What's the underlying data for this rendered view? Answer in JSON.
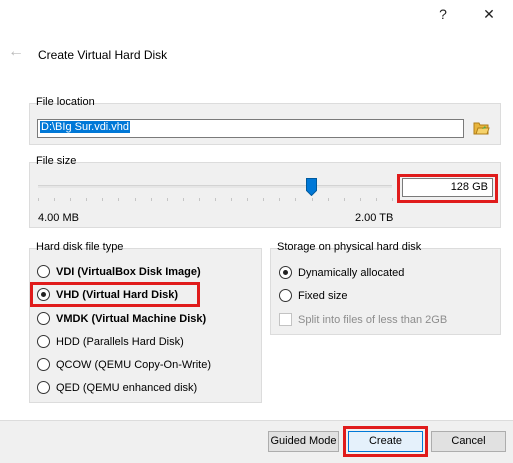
{
  "window": {
    "help_label": "?",
    "close_label": "✕"
  },
  "header": {
    "title": "Create Virtual Hard Disk"
  },
  "file_location": {
    "legend": "File location",
    "value": "D:\\BIg Sur.vdi.vhd"
  },
  "file_size": {
    "legend": "File size",
    "value": "128 GB",
    "min_label": "4.00 MB",
    "max_label": "2.00 TB",
    "slider_fraction": 0.77
  },
  "disk_type": {
    "legend": "Hard disk file type",
    "options": [
      {
        "label": "VDI (VirtualBox Disk Image)",
        "checked": false
      },
      {
        "label": "VHD (Virtual Hard Disk)",
        "checked": true
      },
      {
        "label": "VMDK (Virtual Machine Disk)",
        "checked": false
      },
      {
        "label": "HDD (Parallels Hard Disk)",
        "checked": false
      },
      {
        "label": "QCOW (QEMU Copy-On-Write)",
        "checked": false
      },
      {
        "label": "QED (QEMU enhanced disk)",
        "checked": false
      }
    ]
  },
  "storage": {
    "legend": "Storage on physical hard disk",
    "options": [
      {
        "label": "Dynamically allocated",
        "checked": true
      },
      {
        "label": "Fixed size",
        "checked": false
      }
    ],
    "split_label": "Split into files of less than 2GB"
  },
  "buttons": {
    "guided": "Guided Mode",
    "create": "Create",
    "cancel": "Cancel"
  },
  "colors": {
    "highlight": "#e01b1b",
    "selection": "#0078d7"
  }
}
